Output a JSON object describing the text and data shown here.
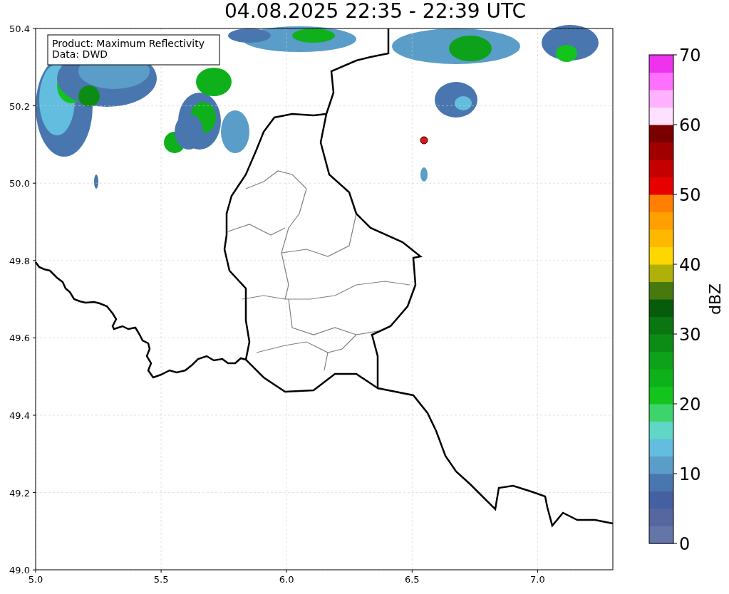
{
  "title": "04.08.2025 22:35 - 22:39 UTC",
  "info_box": {
    "lines": [
      "Product: Maximum Reflectivity",
      "Data: DWD"
    ]
  },
  "axes": {
    "xticks": [
      "5.0",
      "5.5",
      "6.0",
      "6.5",
      "7.0"
    ],
    "yticks": [
      "50.4",
      "50.2",
      "50.0",
      "49.8",
      "49.6",
      "49.4",
      "49.2",
      "49.0"
    ]
  },
  "colorbar": {
    "label": "dBZ",
    "ticks": [
      "70",
      "60",
      "50",
      "40",
      "30",
      "20",
      "10",
      "0"
    ],
    "segments": [
      {
        "color": "#6475a8"
      },
      {
        "color": "#56669f"
      },
      {
        "color": "#4560a0"
      },
      {
        "color": "#4a76b0"
      },
      {
        "color": "#5a9dc8"
      },
      {
        "color": "#62bddf"
      },
      {
        "color": "#60d6c6"
      },
      {
        "color": "#3dd46b"
      },
      {
        "color": "#12c41c"
      },
      {
        "color": "#0eb11a"
      },
      {
        "color": "#0da219"
      },
      {
        "color": "#0c8c15"
      },
      {
        "color": "#0b7512"
      },
      {
        "color": "#075c0c"
      },
      {
        "color": "#477a0e"
      },
      {
        "color": "#b0b00a"
      },
      {
        "color": "#ffd700"
      },
      {
        "color": "#ffb800"
      },
      {
        "color": "#ff9f00"
      },
      {
        "color": "#ff7f00"
      },
      {
        "color": "#e60000"
      },
      {
        "color": "#c40000"
      },
      {
        "color": "#a00000"
      },
      {
        "color": "#7a0000"
      },
      {
        "color": "#ffe0ff"
      },
      {
        "color": "#ffb2ff"
      },
      {
        "color": "#ff70ff"
      },
      {
        "color": "#ee33ee"
      }
    ]
  }
}
